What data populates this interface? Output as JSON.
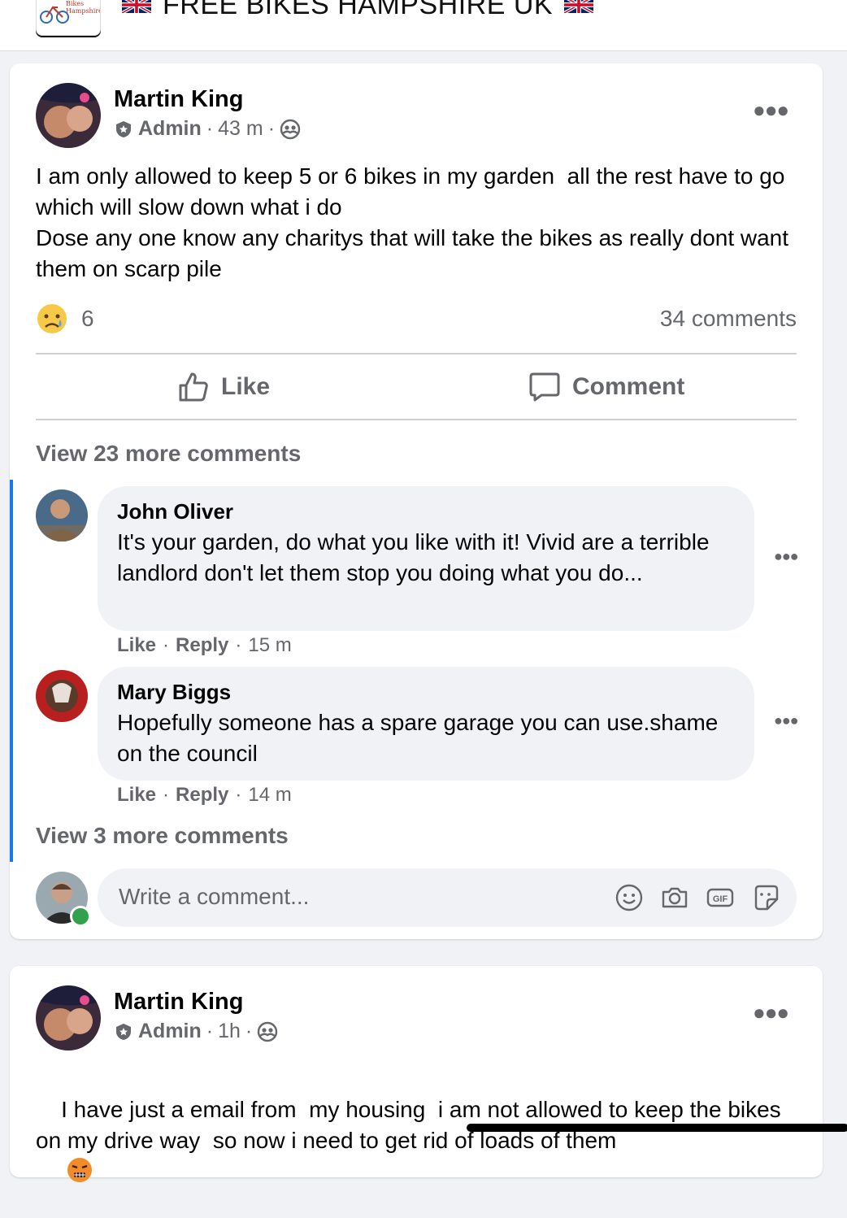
{
  "header": {
    "group_title": "FREE BIKES HAMPSHIRE UK",
    "logo_text": "Free Bikes Hampshire"
  },
  "post1": {
    "author": "Martin King",
    "role": "Admin",
    "time": "43 m",
    "text": "I am only allowed to keep 5 or 6 bikes in my garden  all the rest have to go  which will slow down what i do\nDose any one know any charitys that will take the bikes as really dont want them on scarp pile",
    "reaction_count": "6",
    "comment_count": "34 comments",
    "like_label": "Like",
    "comment_label": "Comment",
    "view_more_top": "View 23 more comments",
    "comments": [
      {
        "name": "John Oliver",
        "text": "It's your garden, do what you like with it! Vivid are a terrible landlord don't let them stop you doing what you do...",
        "like": "Like",
        "reply": "Reply",
        "time": "15 m"
      },
      {
        "name": "Mary Biggs",
        "text": "Hopefully someone has a spare garage you can use.shame on the council",
        "like": "Like",
        "reply": "Reply",
        "time": "14 m"
      }
    ],
    "view_more_bottom": "View 3 more comments",
    "write_placeholder": "Write a comment..."
  },
  "post2": {
    "author": "Martin King",
    "role": "Admin",
    "time": "1h",
    "text": "I have just a email from  my housing  i am not allowed to keep the bikes on my drive way  so now i need to get rid of loads of them"
  },
  "icons": {
    "reaction": "crying-face-icon",
    "admin": "shield-icon",
    "privacy": "group-members-icon",
    "like": "thumbs-up-icon",
    "comment": "speech-bubble-icon",
    "emoji": "smiley-icon",
    "camera": "camera-icon",
    "gif": "gif-icon",
    "sticker": "sticker-icon",
    "angry": "angry-face-icon"
  },
  "colors": {
    "accent": "#1877f2",
    "secondary_text": "#65676b",
    "bubble_bg": "#f0f2f5",
    "online": "#31a24c"
  }
}
